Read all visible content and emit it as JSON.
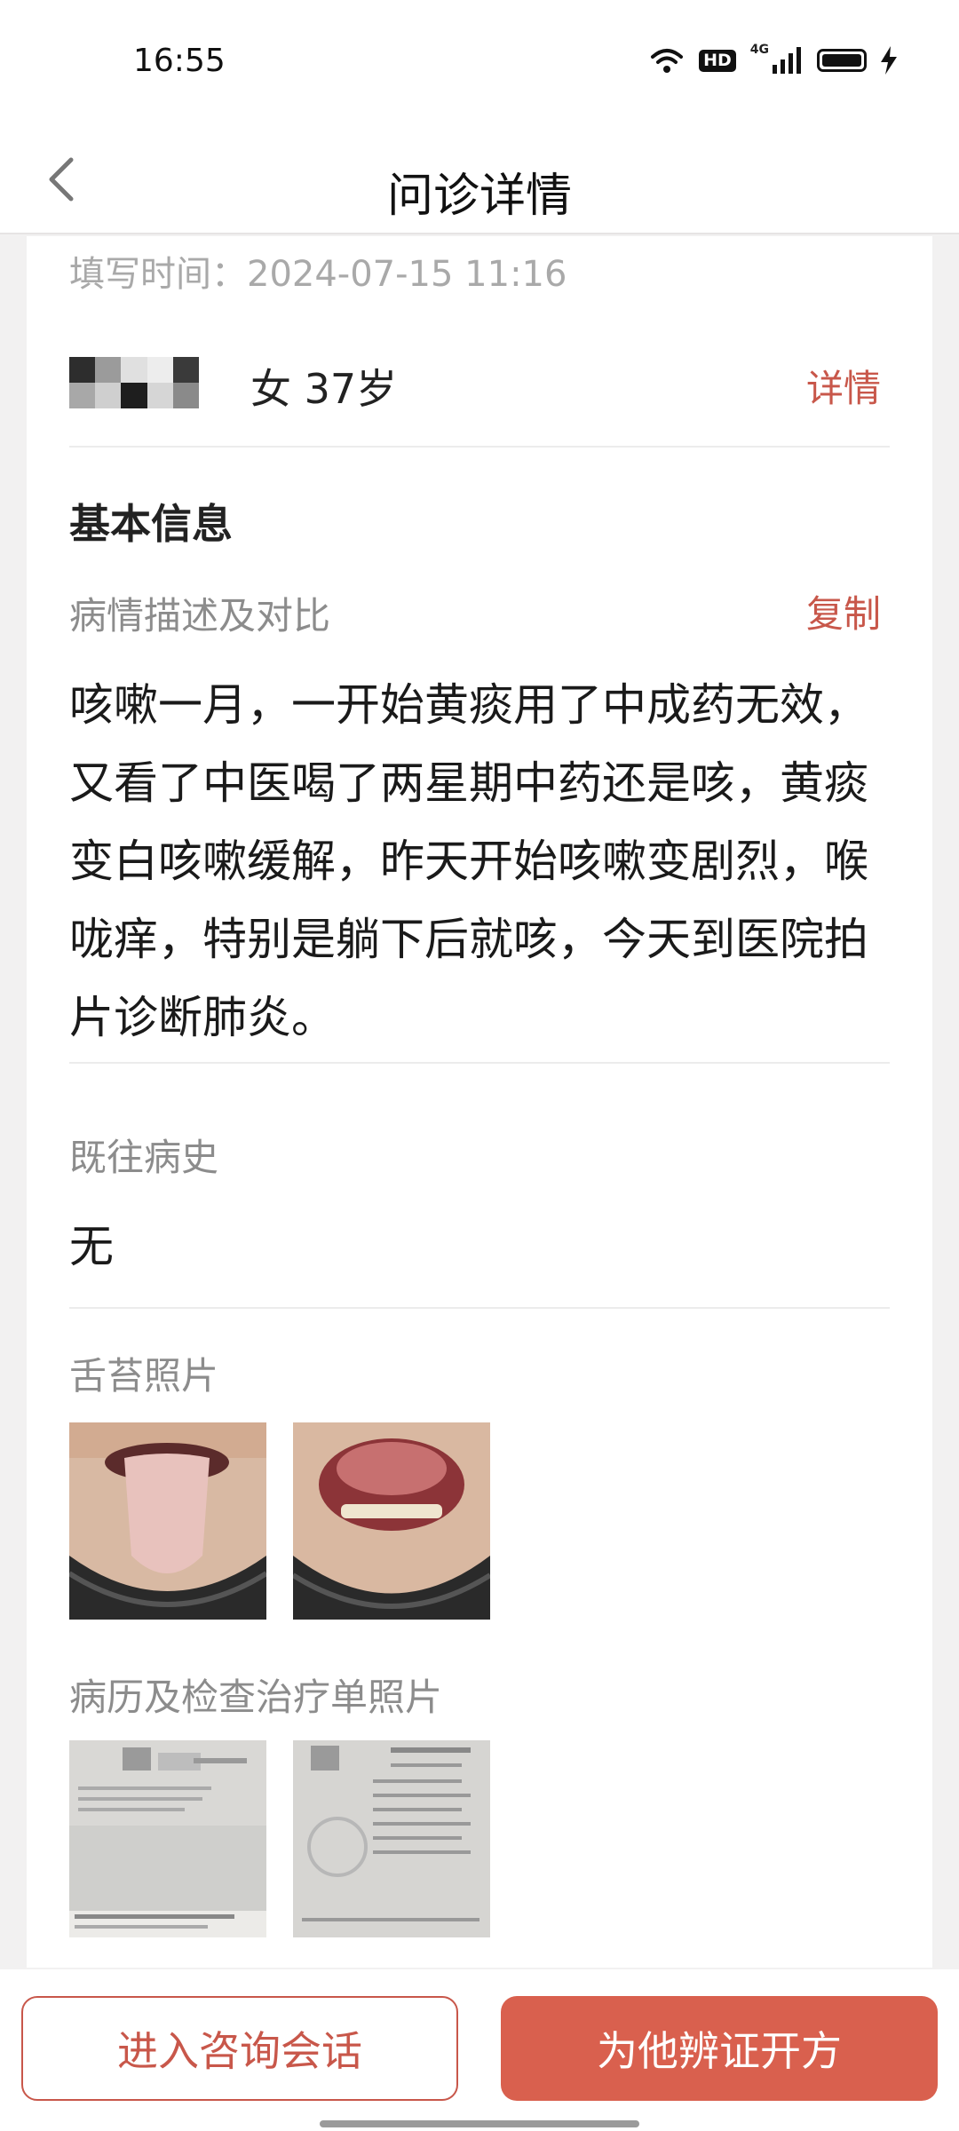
{
  "status_bar": {
    "time": "16:55",
    "hd_label": "HD",
    "network_label": "4G",
    "icons": [
      "wifi-icon",
      "hd-icon",
      "signal-icon",
      "battery-icon",
      "charging-icon"
    ]
  },
  "header": {
    "title": "问诊详情",
    "back_icon": "back-icon"
  },
  "record": {
    "fill_time": "填写时间：2024-07-15 11:16",
    "patient": {
      "info": "女 37岁",
      "detail_link": "详情"
    },
    "basic_info_title": "基本信息",
    "condition": {
      "label": "病情描述及对比",
      "copy_label": "复制",
      "text": "咳嗽一月，一开始黄痰用了中成药无效，又看了中医喝了两星期中药还是咳，黄痰变白咳嗽缓解，昨天开始咳嗽变剧烈，喉咙痒，特别是躺下后就咳，今天到医院拍片诊断肺炎。"
    },
    "history": {
      "label": "既往病史",
      "value": "无"
    },
    "tongue_photos": {
      "label": "舌苔照片",
      "count": 2
    },
    "report_photos": {
      "label": "病历及检查治疗单照片",
      "count": 2
    }
  },
  "actions": {
    "consult": "进入咨询会话",
    "prescribe": "为他辨证开方"
  },
  "colors": {
    "accent": "#c8574a",
    "primary_button": "#d9604e",
    "background": "#f2f1f1"
  }
}
